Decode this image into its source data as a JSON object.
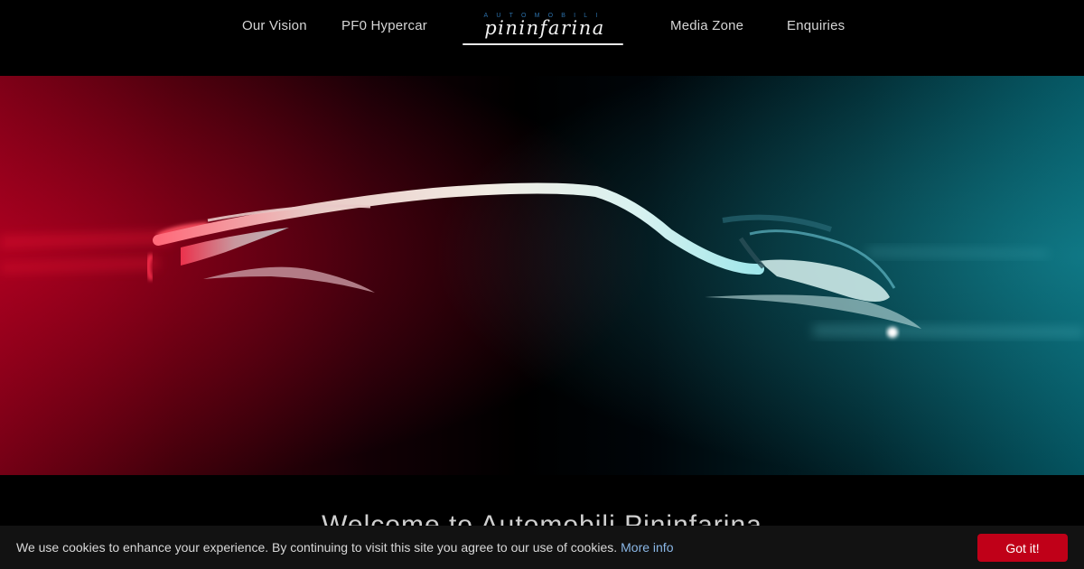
{
  "nav": {
    "items": [
      {
        "label": "Our Vision"
      },
      {
        "label": "PF0 Hypercar"
      },
      {
        "label": "Media Zone"
      },
      {
        "label": "Enquiries"
      }
    ]
  },
  "logo": {
    "top_text": "AUTOMOBILI",
    "script_text": "pininfarina"
  },
  "hero": {
    "colors": {
      "left_glow": "#e0002a",
      "right_glow": "#1ea9b8"
    }
  },
  "welcome": {
    "text": "Welcome to Automobili Pininfarina"
  },
  "cookie": {
    "message": "We use cookies to enhance your experience. By continuing to visit this site you agree to our use of cookies.",
    "link_label": "More info",
    "button_label": "Got it!",
    "button_color": "#c00018"
  }
}
